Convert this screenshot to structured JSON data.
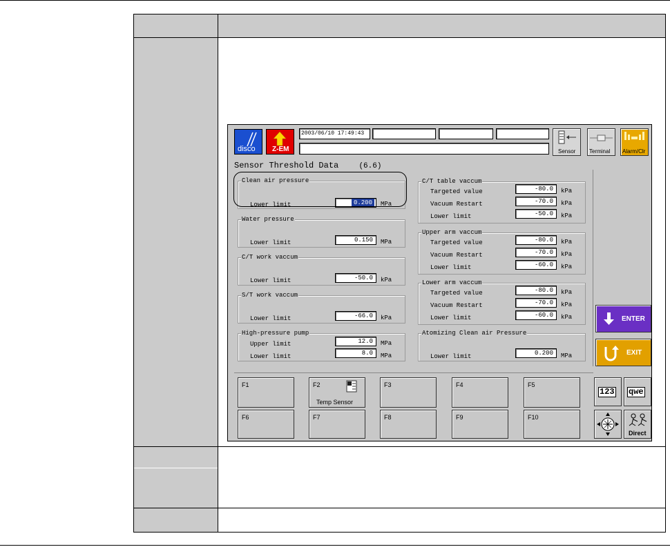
{
  "screen": {
    "datetime": "2003/06/10 17:49:43",
    "logo_text": "disco",
    "zem_label": "Z-EM",
    "top_buttons": {
      "sensor": "Sensor",
      "terminal": "Terminal",
      "alarm": "Alarm/Clr"
    },
    "title": "Sensor Threshold Data",
    "page_no": "(6.6)",
    "left_groups": {
      "clean_air": {
        "title": "Clean air pressure",
        "lower_label": "Lower limit",
        "lower_value": "0.200",
        "unit": "MPa"
      },
      "water": {
        "title": "Water pressure",
        "lower_label": "Lower limit",
        "lower_value": "0.150",
        "unit": "MPa"
      },
      "ct_work": {
        "title": "C/T work vaccum",
        "lower_label": "Lower limit",
        "lower_value": "-50.0",
        "unit": "kPa"
      },
      "st_work": {
        "title": "S/T work vaccum",
        "lower_label": "Lower limit",
        "lower_value": "-66.0",
        "unit": "kPa"
      },
      "hp_pump": {
        "title": "High-pressure pump",
        "upper_label": "Upper limit",
        "upper_value": "12.0",
        "lower_label": "Lower limit",
        "lower_value": "8.0",
        "unit": "MPa"
      }
    },
    "right_groups": {
      "ct_table": {
        "title": "C/T table vaccum",
        "targeted_label": "Targeted value",
        "targeted_value": "-80.0",
        "restart_label": "Vacuum Restart",
        "restart_value": "-70.0",
        "lower_label": "Lower limit",
        "lower_value": "-50.0",
        "unit": "kPa"
      },
      "upper_arm": {
        "title": "Upper arm vaccum",
        "targeted_label": "Targeted value",
        "targeted_value": "-80.0",
        "restart_label": "Vacuum Restart",
        "restart_value": "-70.0",
        "lower_label": "Lower limit",
        "lower_value": "-60.0",
        "unit": "kPa"
      },
      "lower_arm": {
        "title": "Lower arm vaccum",
        "targeted_label": "Targeted value",
        "targeted_value": "-80.0",
        "restart_label": "Vacuum Restart",
        "restart_value": "-70.0",
        "lower_label": "Lower limit",
        "lower_value": "-60.0",
        "unit": "kPa"
      },
      "atomizing": {
        "title": "Atomizing Clean air Pressure",
        "lower_label": "Lower limit",
        "lower_value": "0.200",
        "unit": "MPa"
      }
    },
    "enter_label": "ENTER",
    "exit_label": "EXIT",
    "fkeys": {
      "f1": "F1",
      "f2": "F2",
      "f2_sub": "Temp Sensor",
      "f3": "F3",
      "f4": "F4",
      "f5": "F5",
      "f6": "F6",
      "f7": "F7",
      "f8": "F8",
      "f9": "F9",
      "f10": "F10"
    },
    "side_keys": {
      "num": "123",
      "qwe": "qwe",
      "direct": "Direct"
    }
  },
  "colors": {
    "enter_bg": "#6a2fc4",
    "exit_bg": "#e2a000",
    "alarm_bg": "#e8a800",
    "logo_bg": "#1a4fd0",
    "zem_bg": "#e00000"
  }
}
